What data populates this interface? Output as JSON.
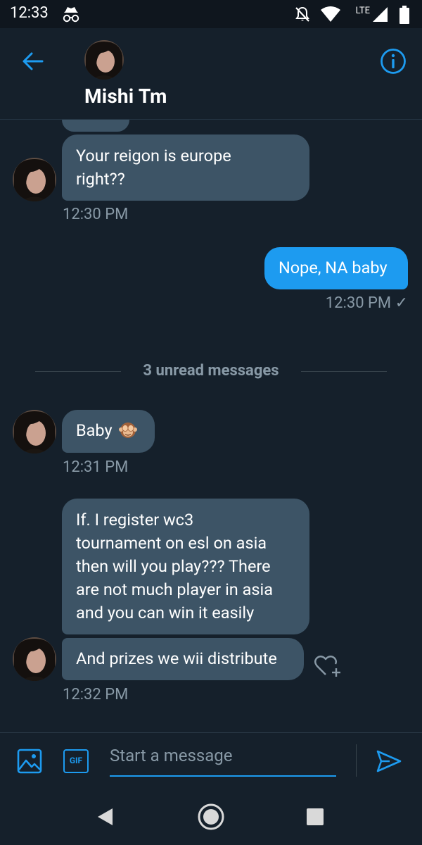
{
  "status_bar": {
    "time": "12:33",
    "network": "LTE"
  },
  "header": {
    "contact_name": "Mishi Tm"
  },
  "messages": [
    {
      "direction": "in",
      "text_lines": [
        "Your reigon is europe",
        "right??"
      ],
      "time": "12:30 PM"
    },
    {
      "direction": "out",
      "text": "Nope, NA baby",
      "time": "12:30 PM ✓"
    },
    {
      "direction": "in",
      "text": "Baby",
      "emoji": "see-no-evil-monkey",
      "time": "12:31 PM"
    },
    {
      "direction": "in",
      "text_lines": [
        "If. I register wc3",
        "tournament on esl on asia",
        "then will you play??? There",
        "are not much player in asia",
        "and you can win it easily"
      ]
    },
    {
      "direction": "in",
      "text": "And prizes we wii distribute",
      "time": "12:32 PM"
    }
  ],
  "divider": {
    "label": "3 unread messages"
  },
  "composer": {
    "placeholder": "Start a message",
    "gif_label": "GIF"
  },
  "colors": {
    "background": "#15202b",
    "incoming_bubble": "#3d5466",
    "outgoing_bubble": "#1d9bf0",
    "accent": "#1d9bf0",
    "muted_text": "#8899a6"
  },
  "icons": [
    "incognito-icon",
    "mute-icon",
    "wifi-icon",
    "signal-icon",
    "battery-icon",
    "back-arrow-icon",
    "info-icon",
    "heart-plus-icon",
    "image-icon",
    "gif-icon",
    "send-icon",
    "back-triangle-icon",
    "home-circle-icon",
    "recents-square-icon"
  ]
}
